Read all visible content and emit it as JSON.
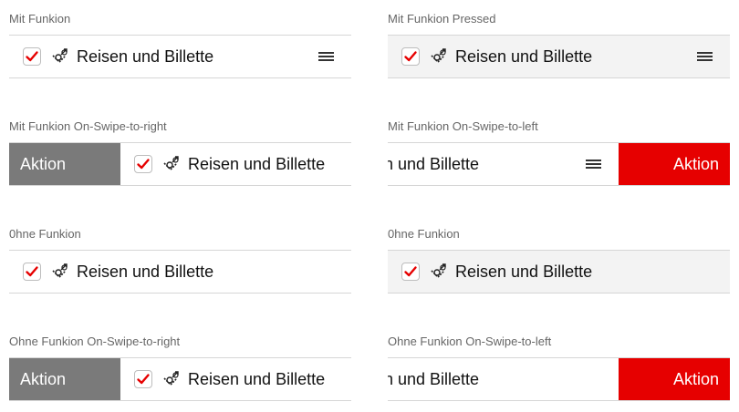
{
  "colors": {
    "accent": "#e60000",
    "action_gray": "#7a7a7a",
    "pressed_bg": "#f3f3f3"
  },
  "sections": [
    {
      "id": "mit-funkion",
      "label": "Mit Funkion",
      "item_text": "Reisen und Billette",
      "checked": true,
      "icon": "train-ticket-icon"
    },
    {
      "id": "mit-funkion-pressed",
      "label": "Mit Funkion Pressed",
      "item_text": "Reisen und Billette",
      "checked": true,
      "icon": "train-ticket-icon"
    },
    {
      "id": "mit-funkion-swipe-right",
      "label": "Mit Funkion On-Swipe-to-right",
      "item_text": "Reisen und Billette",
      "action_label": "Aktion",
      "checked": true,
      "icon": "train-ticket-icon"
    },
    {
      "id": "mit-funkion-swipe-left",
      "label": "Mit Funkion On-Swipe-to-left",
      "item_text": "n und Billette",
      "action_label": "Aktion"
    },
    {
      "id": "ohne-funkion",
      "label": "0hne Funkion",
      "item_text": "Reisen und Billette",
      "checked": true,
      "icon": "train-ticket-icon"
    },
    {
      "id": "ohne-funkion-pressed",
      "label": "0hne Funkion",
      "item_text": "Reisen und Billette",
      "checked": true,
      "icon": "train-ticket-icon"
    },
    {
      "id": "ohne-funkion-swipe-right",
      "label": "Ohne Funkion On-Swipe-to-right",
      "item_text": "Reisen und Billette",
      "action_label": "Aktion",
      "checked": true,
      "icon": "train-ticket-icon"
    },
    {
      "id": "ohne-funkion-swipe-left",
      "label": "Ohne Funkion On-Swipe-to-left",
      "item_text": "n und Billette",
      "action_label": "Aktion"
    }
  ]
}
